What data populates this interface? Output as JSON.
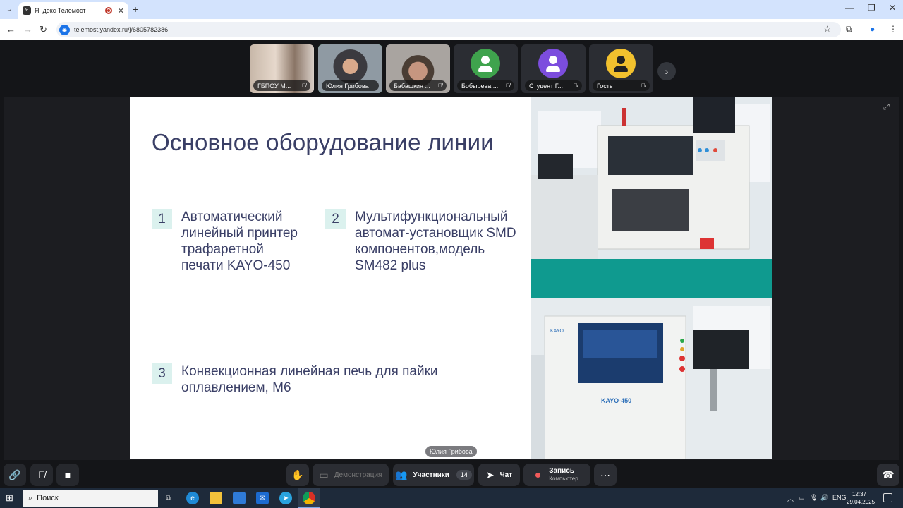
{
  "browser": {
    "tab_title": "Яндекс Телемост",
    "url": "telemost.yandex.ru/j/6805782386"
  },
  "participants_strip": [
    {
      "name": "ГБПОУ М...",
      "type": "video",
      "muted": true
    },
    {
      "name": "Юлия Грибова",
      "type": "video",
      "muted": false,
      "speaking": true
    },
    {
      "name": "Бабашкин ...",
      "type": "video",
      "muted": true
    },
    {
      "name": "Бобырева,...",
      "type": "avatar",
      "avatar_color": "#3fa34d",
      "muted": true
    },
    {
      "name": "Студент Г...",
      "type": "avatar",
      "avatar_color": "#7c4dde",
      "muted": true
    },
    {
      "name": "Гость",
      "type": "avatar",
      "avatar_color": "#f2c12e",
      "muted": true
    }
  ],
  "slide": {
    "title": "Основное оборудование линии",
    "items": [
      {
        "num": "1",
        "lines": [
          "Автоматический",
          "линейный принтер",
          "трафаретной",
          "печати KAYO-450"
        ]
      },
      {
        "num": "2",
        "lines": [
          "Мультифункциональный",
          "автомат-установщик SMD",
          "компонентов,модель",
          "SM482 plus"
        ]
      },
      {
        "num": "3",
        "lines": [
          "Конвекционная линейная печь для пайки",
          "оплавлением, М6"
        ]
      }
    ],
    "machine_label": "KAYO-450"
  },
  "speaker_label": "Юлия Грибова",
  "controls": {
    "demo_label": "Демонстрация",
    "participants_label": "Участники",
    "participants_count": "14",
    "chat_label": "Чат",
    "record_label": "Запись",
    "record_sub": "Компьютер"
  },
  "taskbar": {
    "search_placeholder": "Поиск",
    "lang": "ENG",
    "time": "12:37",
    "date": "29.04.2025"
  }
}
